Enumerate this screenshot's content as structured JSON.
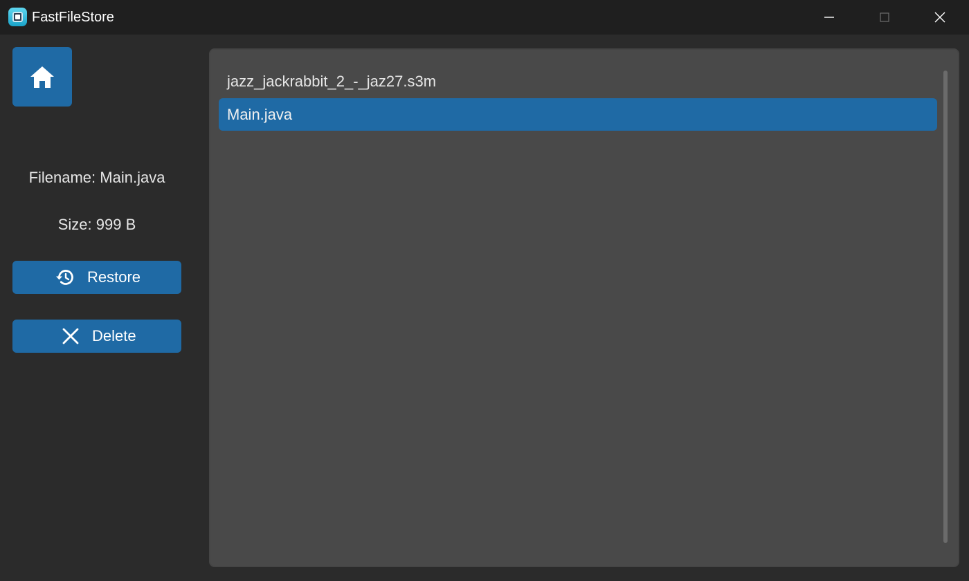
{
  "window": {
    "title": "FastFileStore",
    "controls": {
      "minimize": "minimize-icon",
      "maximize": "maximize-icon",
      "close": "close-icon"
    }
  },
  "sidebar": {
    "home_icon": "home-icon",
    "filename_text": "Filename: Main.java",
    "size_text": "Size: 999 B",
    "restore": {
      "label": "Restore",
      "icon": "history-icon"
    },
    "delete": {
      "label": "Delete",
      "icon": "close-icon"
    }
  },
  "files": {
    "items": [
      {
        "name": "jazz_jackrabbit_2_-_jaz27.s3m",
        "selected": false
      },
      {
        "name": "Main.java",
        "selected": true
      }
    ]
  },
  "colors": {
    "accent": "#1f6aa5",
    "panel": "#494949",
    "background": "#2b2b2b",
    "titlebar": "#1f1f1f"
  }
}
